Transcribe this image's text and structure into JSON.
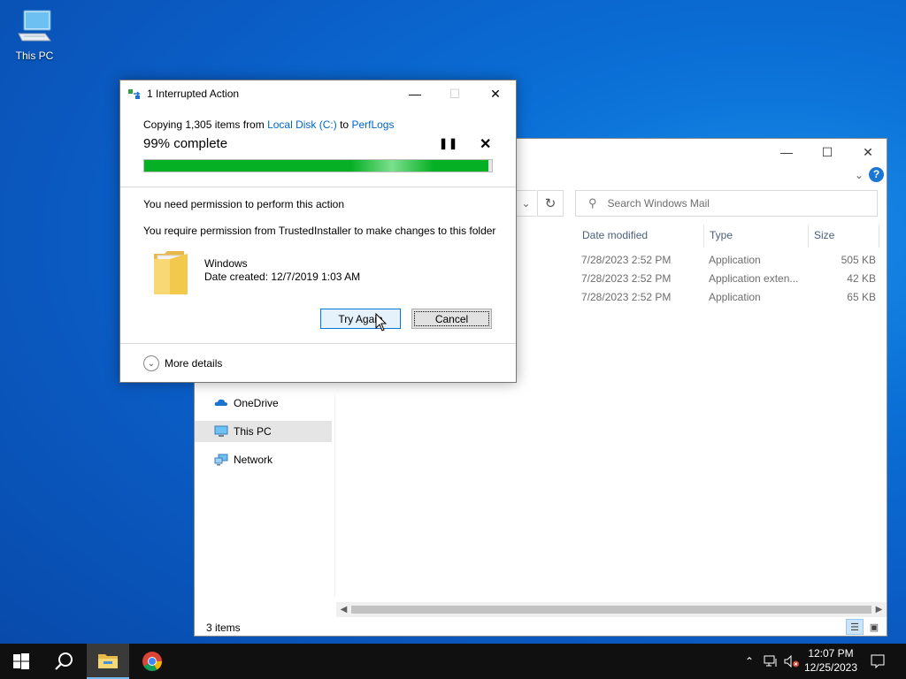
{
  "desktop": {
    "icon_label": "This PC"
  },
  "explorer": {
    "search_placeholder": "Search Windows Mail",
    "columns": [
      "Date modified",
      "Type",
      "Size"
    ],
    "rows": [
      {
        "date": "7/28/2023 2:52 PM",
        "type": "Application",
        "size": "505 KB"
      },
      {
        "date": "7/28/2023 2:52 PM",
        "type": "Application exten...",
        "size": "42 KB"
      },
      {
        "date": "7/28/2023 2:52 PM",
        "type": "Application",
        "size": "65 KB"
      }
    ],
    "nav": [
      {
        "label": "OneDrive",
        "icon": "onedrive-icon"
      },
      {
        "label": "This PC",
        "icon": "computer-icon",
        "selected": true
      },
      {
        "label": "Network",
        "icon": "network-icon"
      }
    ],
    "status": "3 items",
    "help": "?"
  },
  "dialog": {
    "title": "1 Interrupted Action",
    "copying_prefix": "Copying 1,305 items from ",
    "source": "Local Disk (C:)",
    "to": " to ",
    "dest": "PerfLogs",
    "percent_text": "99% complete",
    "progress": 0.99,
    "message1": "You need permission to perform this action",
    "message2": "You require permission from TrustedInstaller to make changes to this folder",
    "folder_name": "Windows",
    "folder_date": "Date created: 12/7/2019 1:03 AM",
    "try_again": "Try Again",
    "cancel": "Cancel",
    "more_details": "More details"
  },
  "taskbar": {
    "time": "12:07 PM",
    "date": "12/25/2023"
  },
  "colors": {
    "accent": "#0078d7",
    "progress": "#06b025",
    "link": "#0066cc",
    "desktop": "#0a5cc4"
  }
}
